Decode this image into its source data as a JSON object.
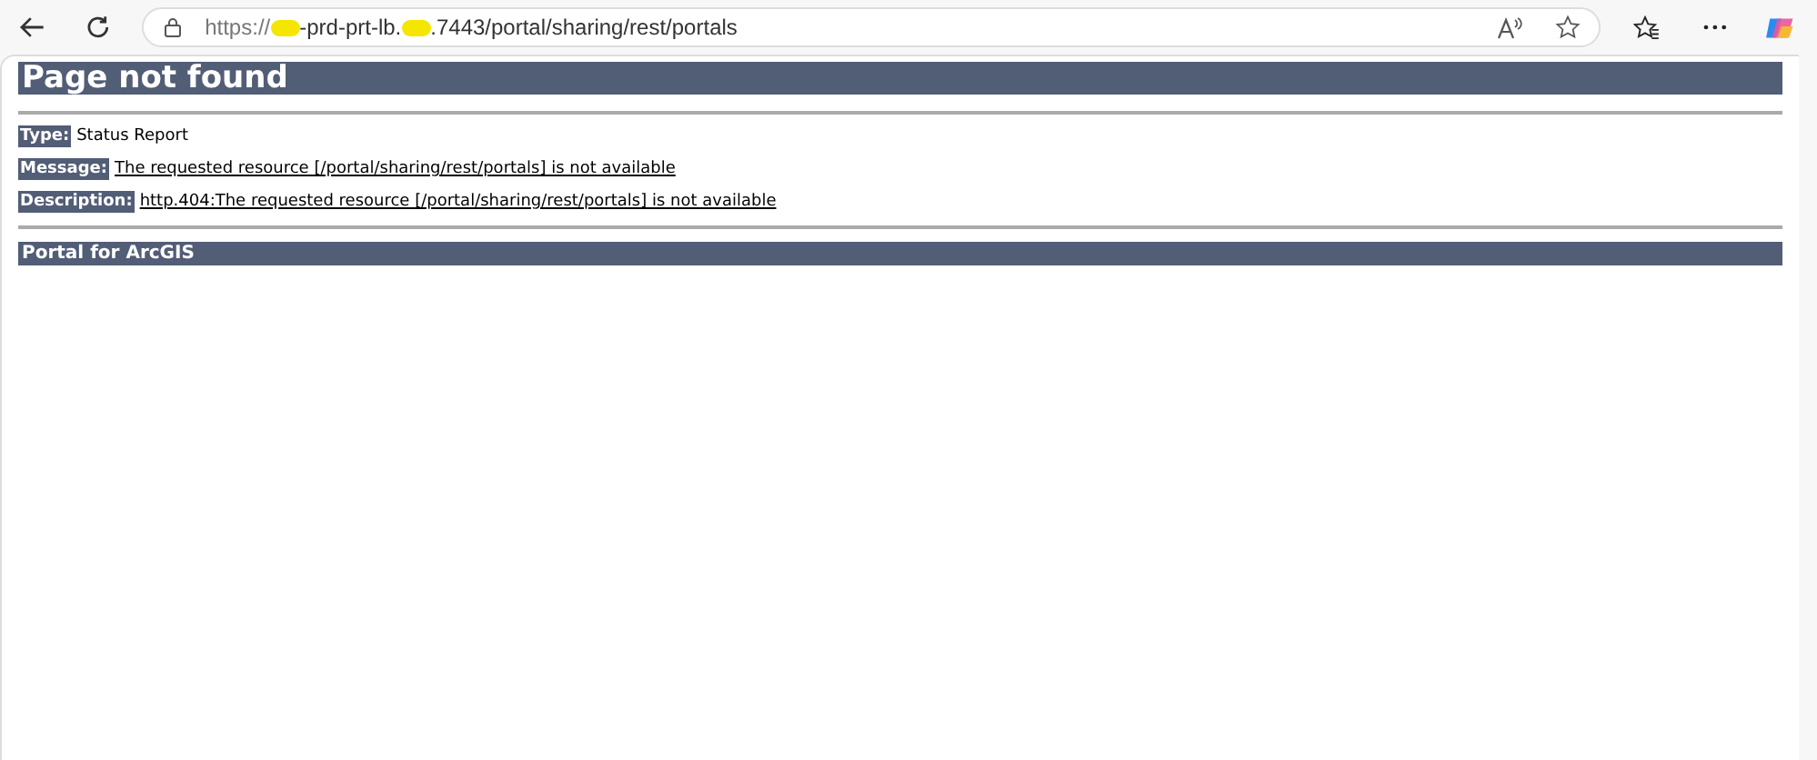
{
  "browser": {
    "url_parts": [
      "https://",
      "-prd-prt-lb.",
      ".7443/portal/sharing/rest/portals"
    ]
  },
  "page": {
    "title": "Page not found",
    "fields": [
      {
        "label": "Type:",
        "value": "Status Report",
        "underlined": false
      },
      {
        "label": "Message:",
        "value": "The requested resource [/portal/sharing/rest/portals] is not available",
        "underlined": true
      },
      {
        "label": "Description:",
        "value": "http.404:The requested resource [/portal/sharing/rest/portals] is not available",
        "underlined": true
      }
    ],
    "footer": "Portal for ArcGIS"
  }
}
